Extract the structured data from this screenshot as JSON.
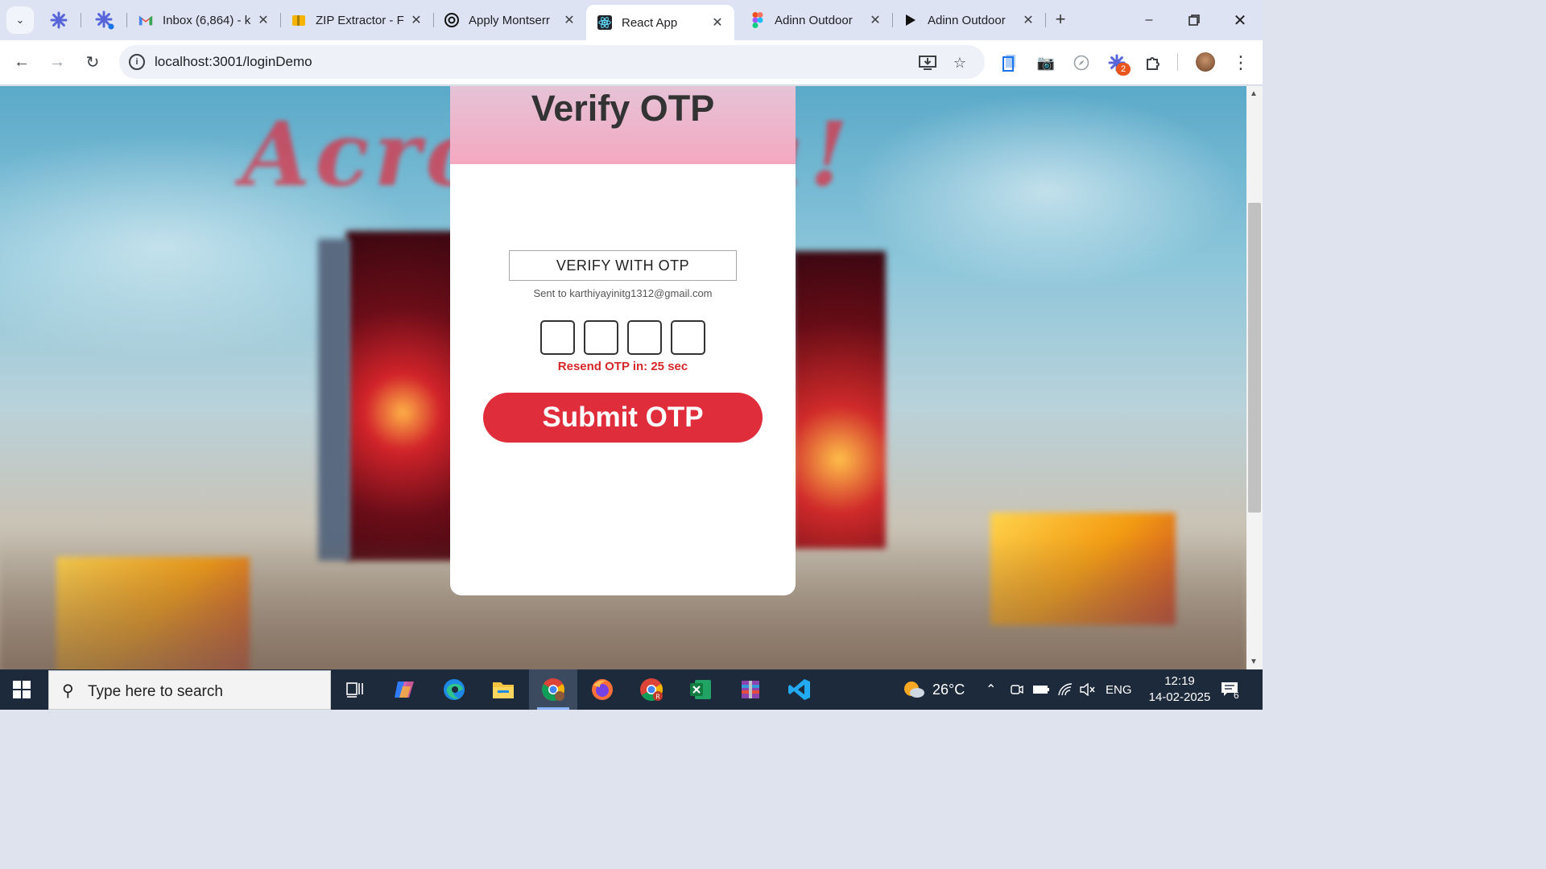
{
  "browser": {
    "tabs": [
      {
        "title": "Inbox (6,864) - k",
        "icon": "gmail-icon"
      },
      {
        "title": "ZIP Extractor - F",
        "icon": "zip-extractor-icon"
      },
      {
        "title": "Apply Montserr",
        "icon": "openai-icon"
      },
      {
        "title": "React App",
        "icon": "react-icon",
        "active": true
      },
      {
        "title": "Adinn Outdoor",
        "icon": "figma-icon"
      },
      {
        "title": "Adinn Outdoor",
        "icon": "play-icon"
      }
    ],
    "url": "localhost:3001/loginDemo",
    "extension_badge": "2"
  },
  "page": {
    "title": "Verify OTP",
    "verify_label": "VERIFY WITH OTP",
    "sent_to": "Sent to karthiyayinitg1312@gmail.com",
    "otp_digits": [
      "",
      "",
      "",
      ""
    ],
    "resend_text": "Resend OTP in: 25 sec",
    "submit_label": "Submit OTP",
    "background_text": "Acros        adia!",
    "accent_color": "#e02d3c",
    "header_color": "#f4a8c0"
  },
  "taskbar": {
    "search_placeholder": "Type here to search",
    "weather": "26°C",
    "language": "ENG",
    "time": "12:19",
    "date": "14-02-2025",
    "notification_count": "6"
  }
}
